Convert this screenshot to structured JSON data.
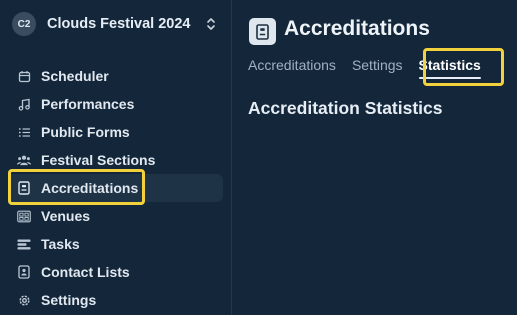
{
  "org": {
    "initials": "C2",
    "name": "Clouds Festival 2024",
    "chevron_icon": "chevron-up-down-icon"
  },
  "sidebar": {
    "items": [
      {
        "label": "Scheduler",
        "icon": "calendar-icon",
        "active": false
      },
      {
        "label": "Performances",
        "icon": "music-note-icon",
        "active": false
      },
      {
        "label": "Public Forms",
        "icon": "list-icon",
        "active": false
      },
      {
        "label": "Festival Sections",
        "icon": "users-icon",
        "active": false
      },
      {
        "label": "Accreditations",
        "icon": "badge-icon",
        "active": true
      },
      {
        "label": "Venues",
        "icon": "grid-icon",
        "active": false
      },
      {
        "label": "Tasks",
        "icon": "tasks-icon",
        "active": false
      },
      {
        "label": "Contact Lists",
        "icon": "contact-book-icon",
        "active": false
      },
      {
        "label": "Settings",
        "icon": "gear-icon",
        "active": false
      }
    ]
  },
  "header": {
    "title": "Accreditations",
    "icon": "badge-icon"
  },
  "tabs": [
    {
      "label": "Accreditations",
      "active": false
    },
    {
      "label": "Settings",
      "active": false
    },
    {
      "label": "Statistics",
      "active": true
    }
  ],
  "main": {
    "section_title": "Accreditation Statistics"
  },
  "colors": {
    "background": "#14273a",
    "highlight": "#f2d23c",
    "active_item_bg": "#1f3347"
  }
}
